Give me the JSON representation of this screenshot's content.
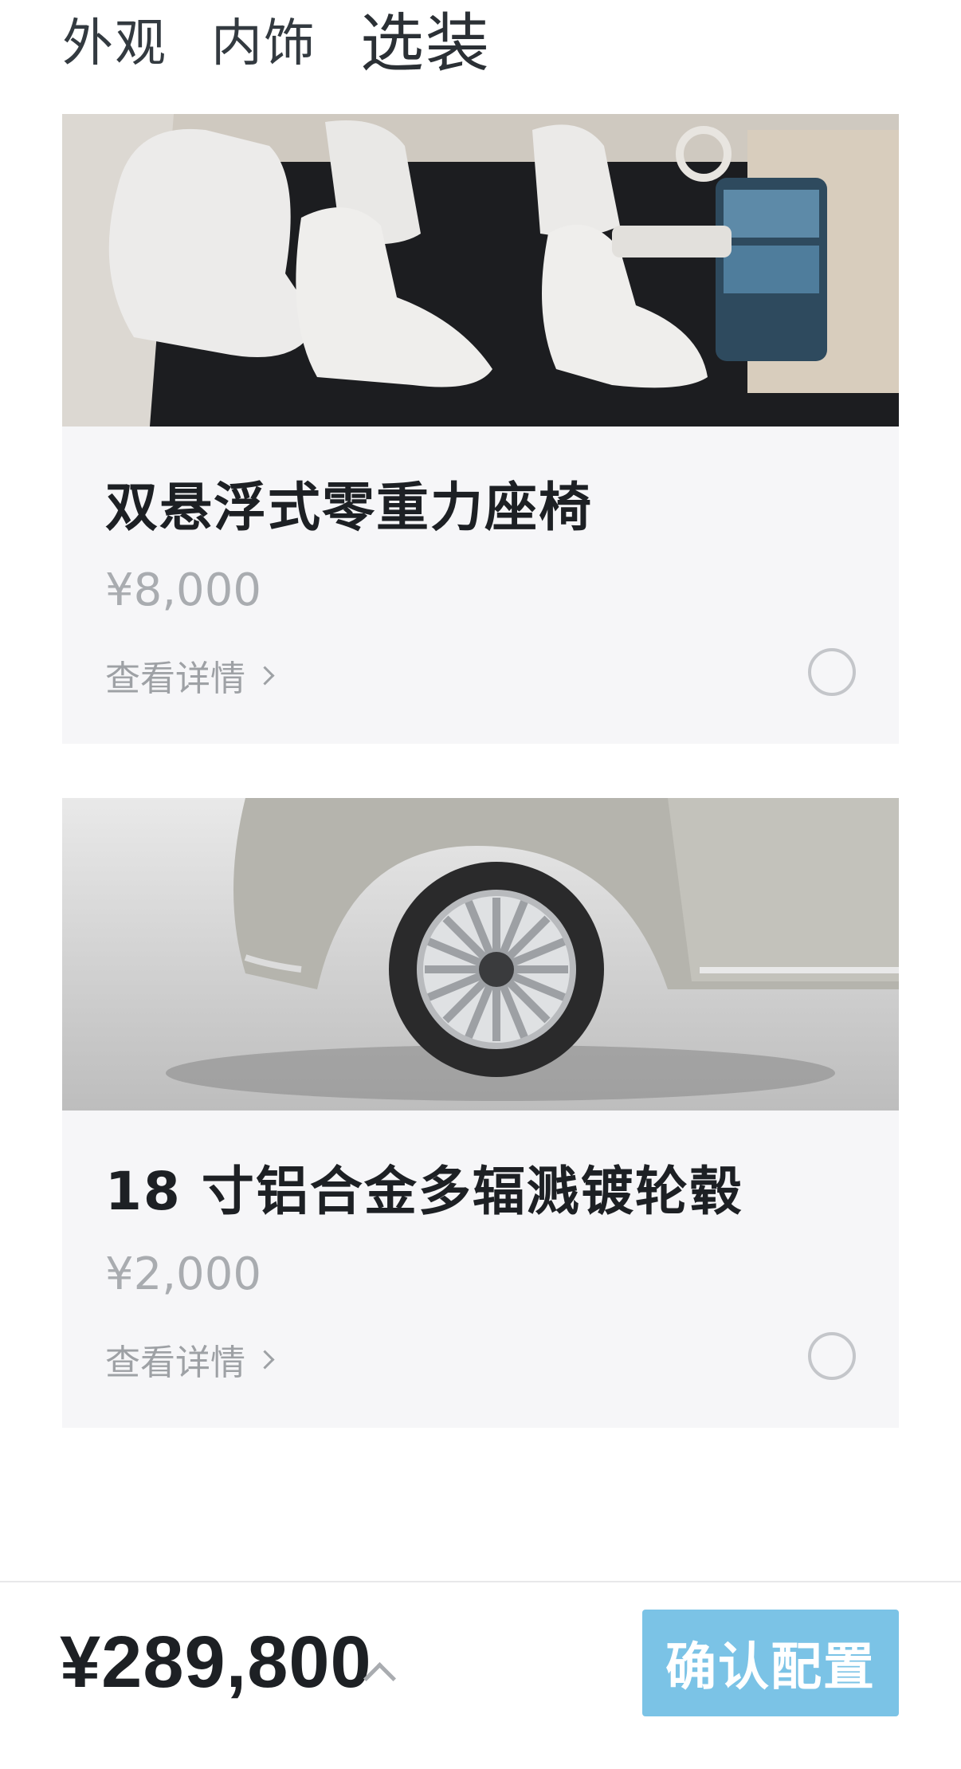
{
  "tabs": [
    {
      "label": "外观"
    },
    {
      "label": "内饰"
    },
    {
      "label": "选装"
    }
  ],
  "options": [
    {
      "name": "双悬浮式零重力座椅",
      "price": "¥8,000",
      "detail_label": "查看详情",
      "selected": false
    },
    {
      "name": "18 寸铝合金多辐溅镀轮毂",
      "price": "¥2,000",
      "detail_label": "查看详情",
      "selected": false
    }
  ],
  "footer": {
    "total": "¥289,800",
    "confirm_label": "确认配置"
  },
  "colors": {
    "confirm_button": "#7bc3e6",
    "card_bg": "#f6f6f8"
  }
}
